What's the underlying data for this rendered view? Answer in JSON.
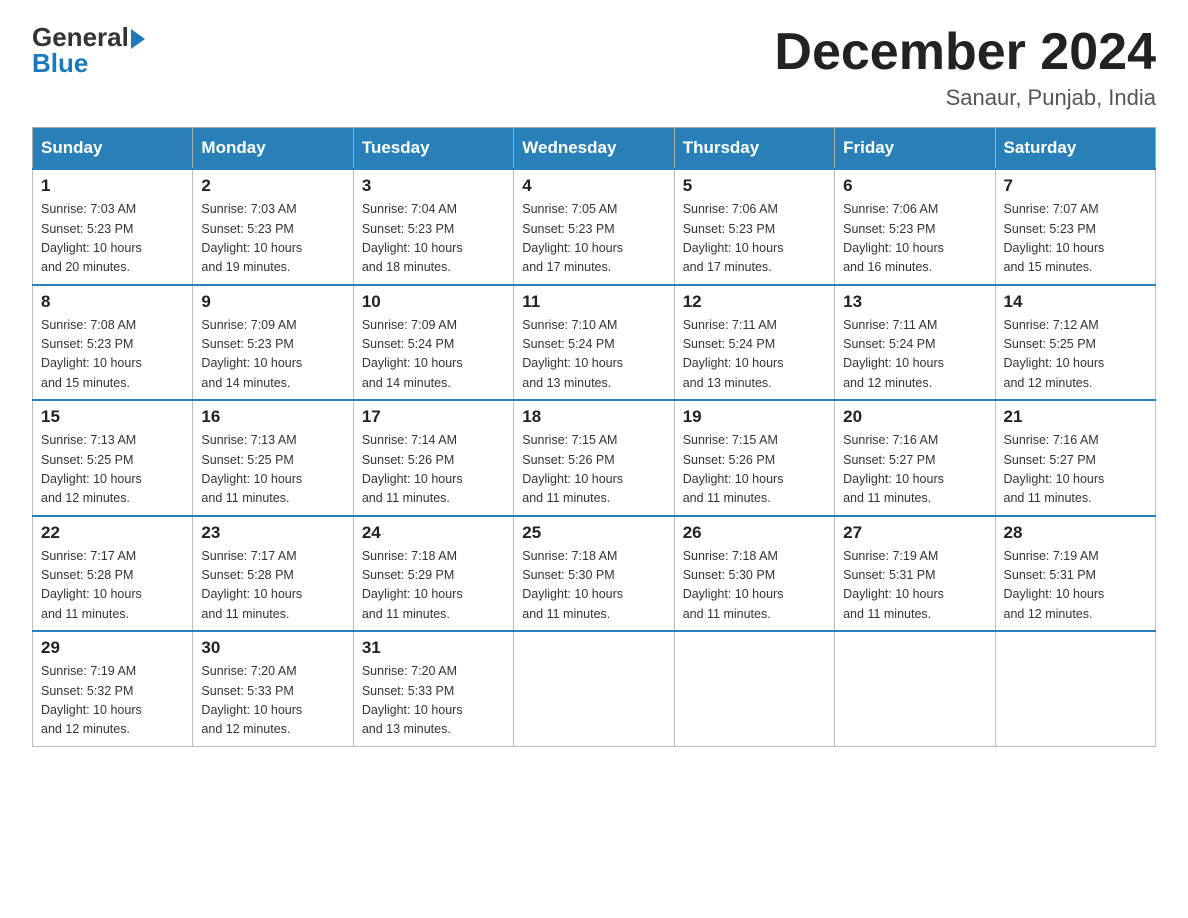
{
  "header": {
    "logo_general": "General",
    "logo_blue": "Blue",
    "month_title": "December 2024",
    "subtitle": "Sanaur, Punjab, India"
  },
  "days_of_week": [
    "Sunday",
    "Monday",
    "Tuesday",
    "Wednesday",
    "Thursday",
    "Friday",
    "Saturday"
  ],
  "weeks": [
    [
      {
        "day": "1",
        "sunrise": "7:03 AM",
        "sunset": "5:23 PM",
        "daylight": "10 hours and 20 minutes."
      },
      {
        "day": "2",
        "sunrise": "7:03 AM",
        "sunset": "5:23 PM",
        "daylight": "10 hours and 19 minutes."
      },
      {
        "day": "3",
        "sunrise": "7:04 AM",
        "sunset": "5:23 PM",
        "daylight": "10 hours and 18 minutes."
      },
      {
        "day": "4",
        "sunrise": "7:05 AM",
        "sunset": "5:23 PM",
        "daylight": "10 hours and 17 minutes."
      },
      {
        "day": "5",
        "sunrise": "7:06 AM",
        "sunset": "5:23 PM",
        "daylight": "10 hours and 17 minutes."
      },
      {
        "day": "6",
        "sunrise": "7:06 AM",
        "sunset": "5:23 PM",
        "daylight": "10 hours and 16 minutes."
      },
      {
        "day": "7",
        "sunrise": "7:07 AM",
        "sunset": "5:23 PM",
        "daylight": "10 hours and 15 minutes."
      }
    ],
    [
      {
        "day": "8",
        "sunrise": "7:08 AM",
        "sunset": "5:23 PM",
        "daylight": "10 hours and 15 minutes."
      },
      {
        "day": "9",
        "sunrise": "7:09 AM",
        "sunset": "5:23 PM",
        "daylight": "10 hours and 14 minutes."
      },
      {
        "day": "10",
        "sunrise": "7:09 AM",
        "sunset": "5:24 PM",
        "daylight": "10 hours and 14 minutes."
      },
      {
        "day": "11",
        "sunrise": "7:10 AM",
        "sunset": "5:24 PM",
        "daylight": "10 hours and 13 minutes."
      },
      {
        "day": "12",
        "sunrise": "7:11 AM",
        "sunset": "5:24 PM",
        "daylight": "10 hours and 13 minutes."
      },
      {
        "day": "13",
        "sunrise": "7:11 AM",
        "sunset": "5:24 PM",
        "daylight": "10 hours and 12 minutes."
      },
      {
        "day": "14",
        "sunrise": "7:12 AM",
        "sunset": "5:25 PM",
        "daylight": "10 hours and 12 minutes."
      }
    ],
    [
      {
        "day": "15",
        "sunrise": "7:13 AM",
        "sunset": "5:25 PM",
        "daylight": "10 hours and 12 minutes."
      },
      {
        "day": "16",
        "sunrise": "7:13 AM",
        "sunset": "5:25 PM",
        "daylight": "10 hours and 11 minutes."
      },
      {
        "day": "17",
        "sunrise": "7:14 AM",
        "sunset": "5:26 PM",
        "daylight": "10 hours and 11 minutes."
      },
      {
        "day": "18",
        "sunrise": "7:15 AM",
        "sunset": "5:26 PM",
        "daylight": "10 hours and 11 minutes."
      },
      {
        "day": "19",
        "sunrise": "7:15 AM",
        "sunset": "5:26 PM",
        "daylight": "10 hours and 11 minutes."
      },
      {
        "day": "20",
        "sunrise": "7:16 AM",
        "sunset": "5:27 PM",
        "daylight": "10 hours and 11 minutes."
      },
      {
        "day": "21",
        "sunrise": "7:16 AM",
        "sunset": "5:27 PM",
        "daylight": "10 hours and 11 minutes."
      }
    ],
    [
      {
        "day": "22",
        "sunrise": "7:17 AM",
        "sunset": "5:28 PM",
        "daylight": "10 hours and 11 minutes."
      },
      {
        "day": "23",
        "sunrise": "7:17 AM",
        "sunset": "5:28 PM",
        "daylight": "10 hours and 11 minutes."
      },
      {
        "day": "24",
        "sunrise": "7:18 AM",
        "sunset": "5:29 PM",
        "daylight": "10 hours and 11 minutes."
      },
      {
        "day": "25",
        "sunrise": "7:18 AM",
        "sunset": "5:30 PM",
        "daylight": "10 hours and 11 minutes."
      },
      {
        "day": "26",
        "sunrise": "7:18 AM",
        "sunset": "5:30 PM",
        "daylight": "10 hours and 11 minutes."
      },
      {
        "day": "27",
        "sunrise": "7:19 AM",
        "sunset": "5:31 PM",
        "daylight": "10 hours and 11 minutes."
      },
      {
        "day": "28",
        "sunrise": "7:19 AM",
        "sunset": "5:31 PM",
        "daylight": "10 hours and 12 minutes."
      }
    ],
    [
      {
        "day": "29",
        "sunrise": "7:19 AM",
        "sunset": "5:32 PM",
        "daylight": "10 hours and 12 minutes."
      },
      {
        "day": "30",
        "sunrise": "7:20 AM",
        "sunset": "5:33 PM",
        "daylight": "10 hours and 12 minutes."
      },
      {
        "day": "31",
        "sunrise": "7:20 AM",
        "sunset": "5:33 PM",
        "daylight": "10 hours and 13 minutes."
      },
      null,
      null,
      null,
      null
    ]
  ],
  "labels": {
    "sunrise": "Sunrise:",
    "sunset": "Sunset:",
    "daylight": "Daylight:"
  }
}
